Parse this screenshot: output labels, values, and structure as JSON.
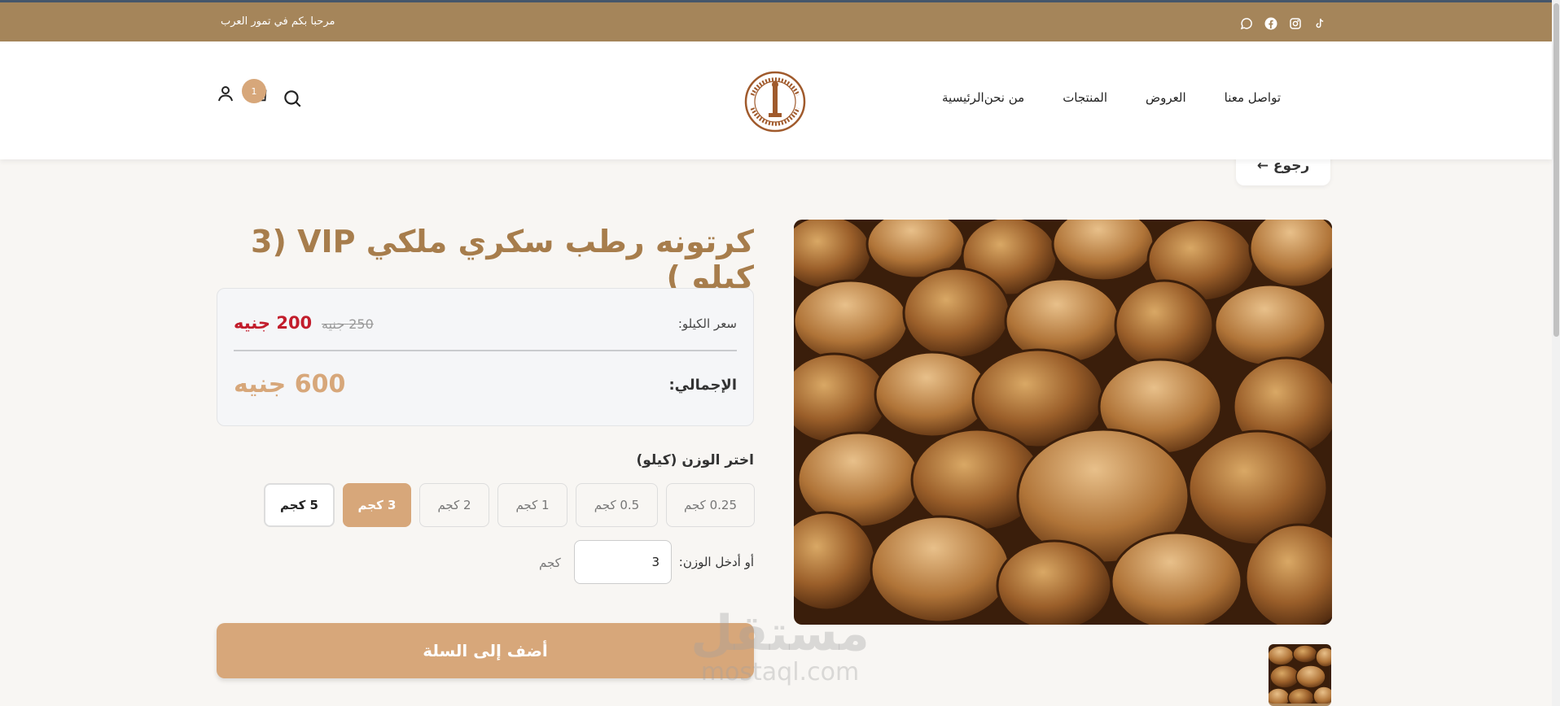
{
  "topbar": {
    "welcome": "مرحبا بكم في تمور العرب",
    "socials": [
      "tiktok-icon",
      "instagram-icon",
      "facebook-icon",
      "whatsapp-icon"
    ]
  },
  "header": {
    "nav": [
      "الرئيسية",
      "من نحن",
      "المنتجات",
      "العروض",
      "تواصل معنا"
    ],
    "cart_count": "1",
    "logo": "seal-logo"
  },
  "back_label": "← رجوع",
  "product": {
    "title": "كرتونه رطب سكري ملكي VIP (3 كيلو )",
    "price_label": "سعر الكيلو:",
    "price_new": "200 جنيه",
    "price_old": "250 جنيه",
    "total_label": "الإجمالي:",
    "total": "600 جنيه",
    "weight_label": "اختر الوزن (كيلو)",
    "weights": [
      "0.25 كجم",
      "0.5 كجم",
      "1 كجم",
      "2 كجم",
      "3 كجم",
      "5 كجم"
    ],
    "selected_weight": "3 كجم",
    "custom_label": "أو أدخل الوزن:",
    "custom_value": "3",
    "unit": "كجم",
    "add_to_cart": "أضف إلى السلة"
  },
  "watermark": {
    "ar": "مستقل",
    "en": "mostaql.com"
  },
  "colors": {
    "topbar": "#a5855a",
    "accent": "#d7a77a",
    "title": "#a77d4c",
    "sale": "#c21d2c"
  }
}
